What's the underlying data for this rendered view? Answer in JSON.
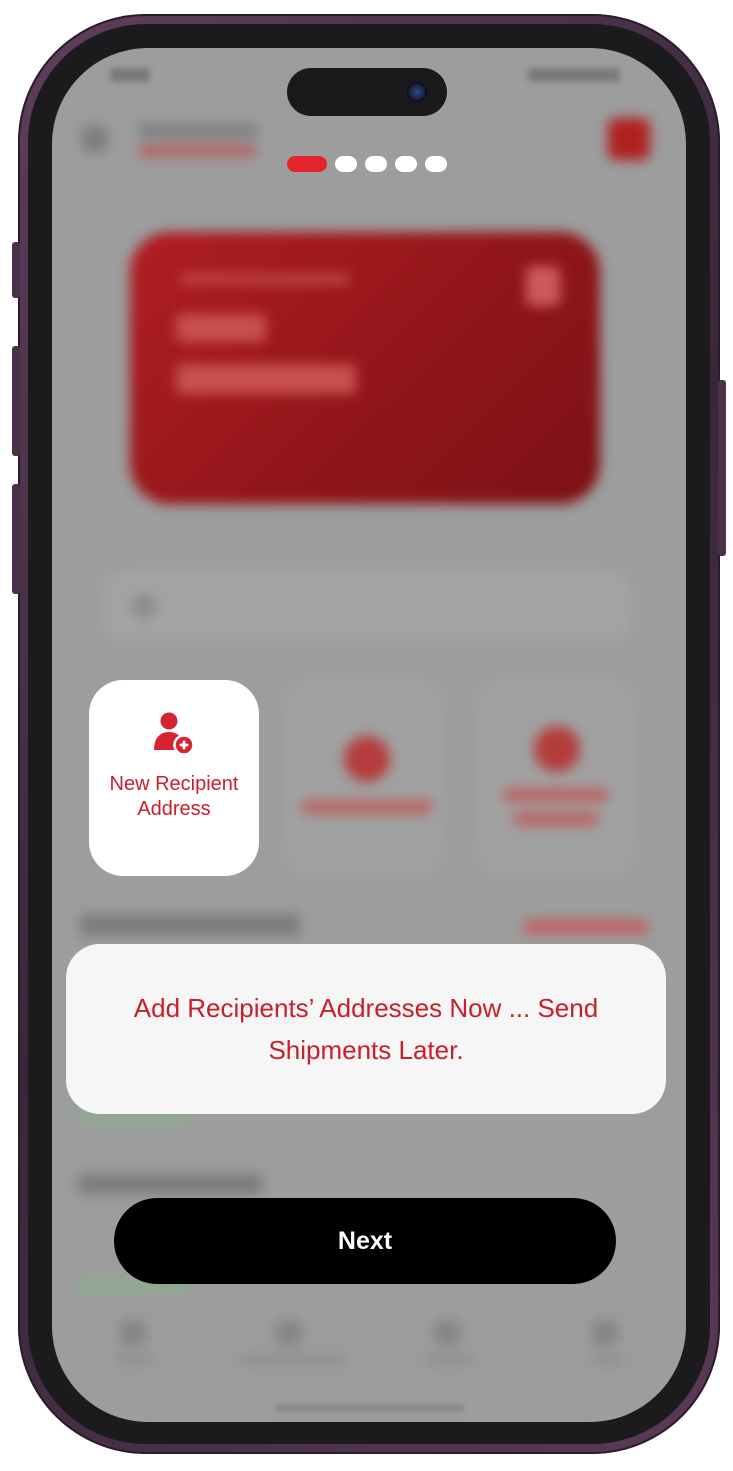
{
  "onboarding": {
    "progress": {
      "total_steps": 5,
      "current_step": 1
    },
    "highlight": {
      "label": "New Recipient Address",
      "icon": "add-user-icon"
    },
    "message": "Add Recipients’ Addresses Now ... Send Shipments Later.",
    "next_label": "Next"
  },
  "colors": {
    "accent": "#e5232b",
    "text_red": "#c91f2a",
    "overlay": "#9d9d9d",
    "button": "#000000"
  }
}
